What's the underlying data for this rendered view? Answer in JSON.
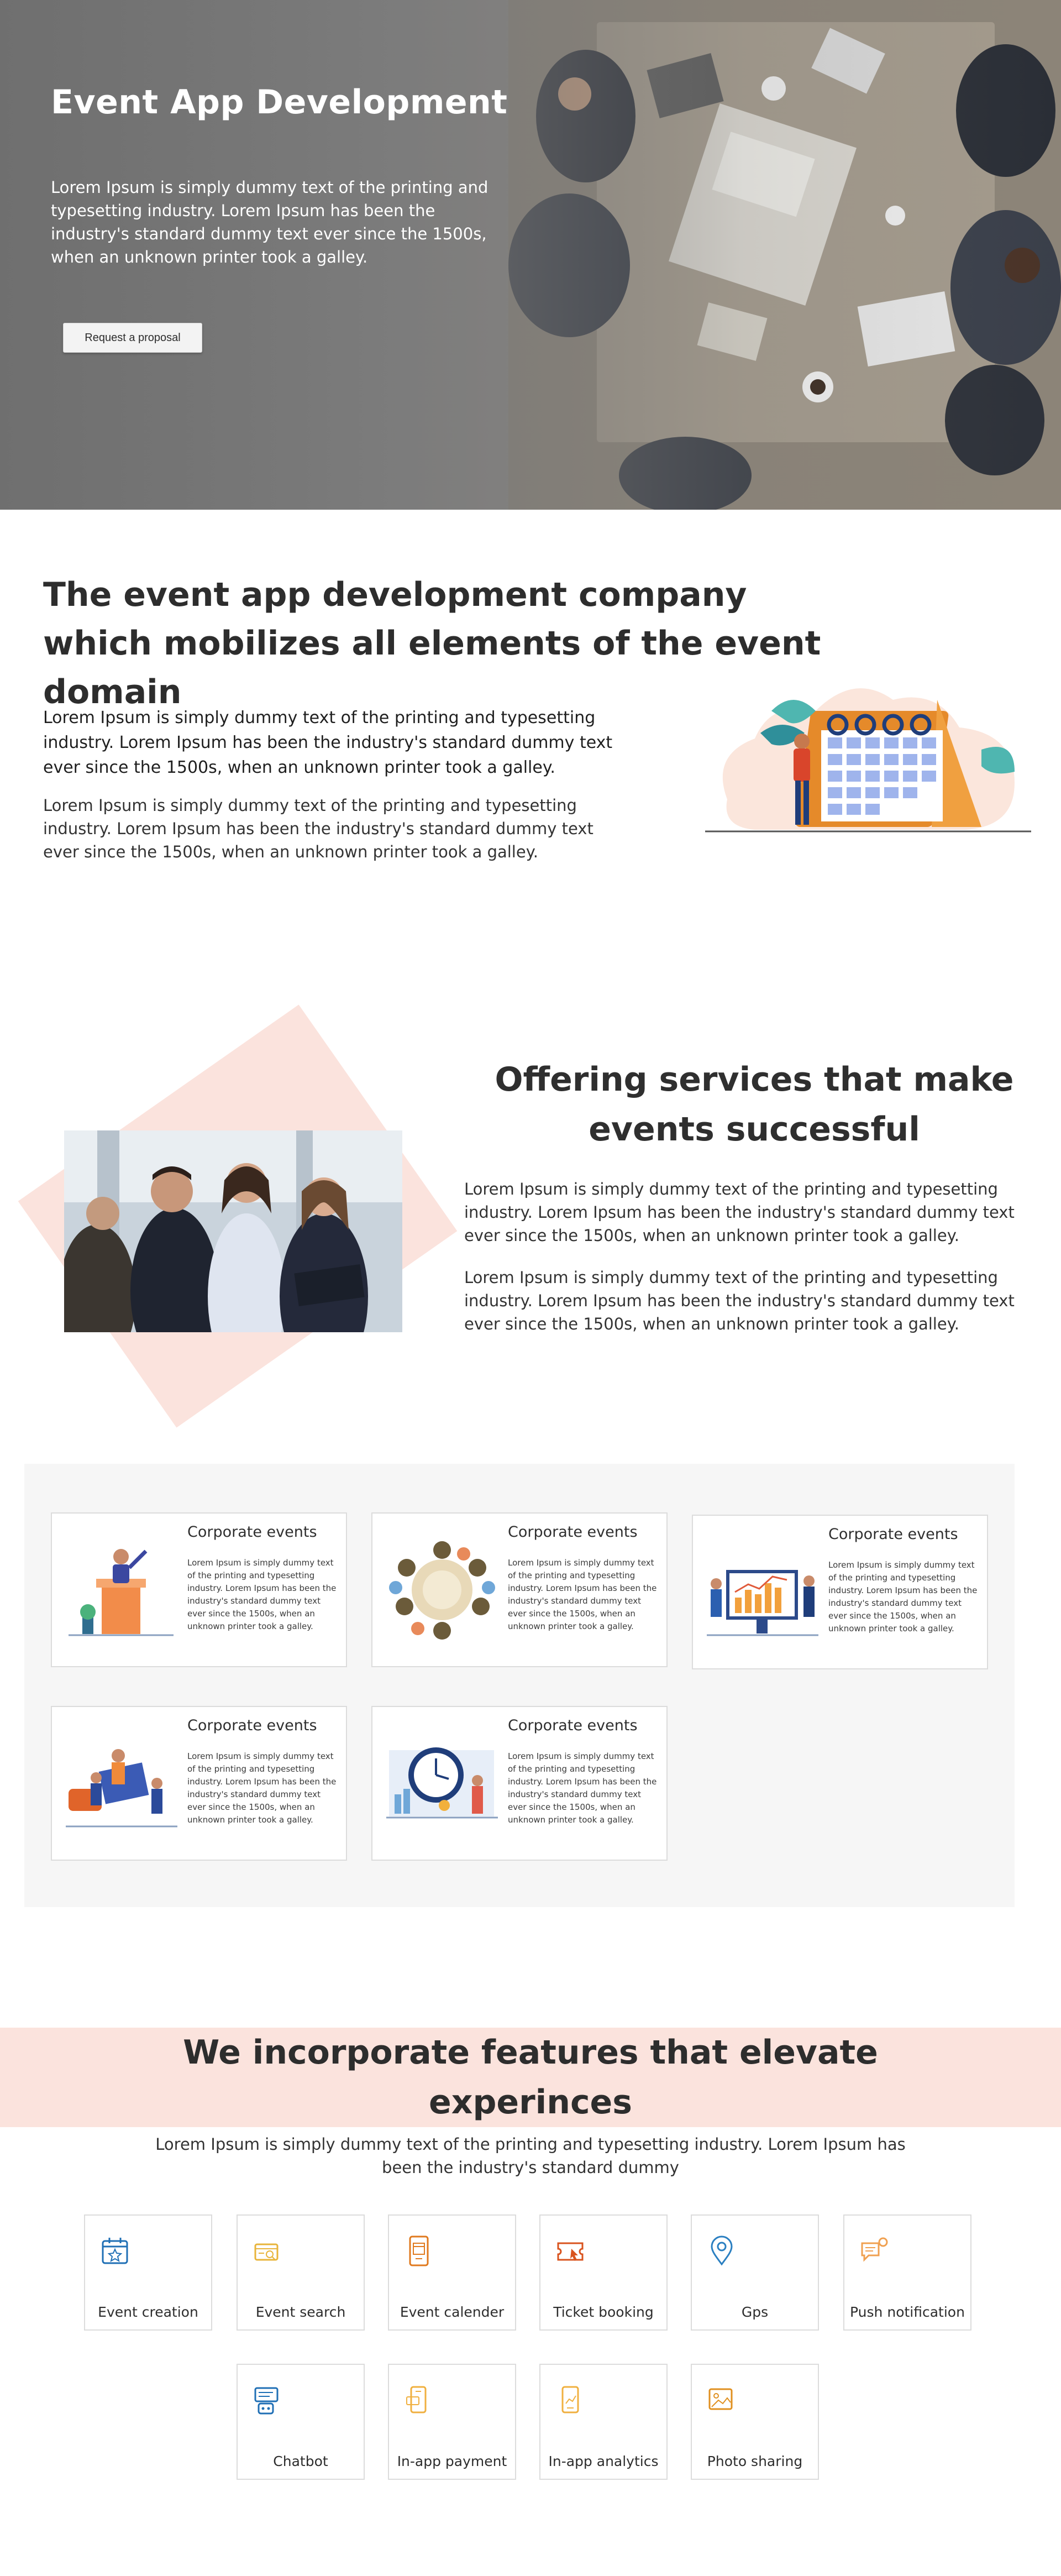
{
  "hero": {
    "title": "Event App Development",
    "text": "Lorem Ipsum is simply dummy text of the printing and typesetting industry. Lorem Ipsum has been the industry's standard dummy text ever since the 1500s, when an unknown printer took a galley.",
    "button_label": "Request a proposal"
  },
  "intro": {
    "title": "The event app development company which mobilizes all elements of the event domain",
    "lead": "Lorem Ipsum is simply dummy text of the printing and typesetting industry. Lorem Ipsum has been the industry's standard dummy text ever since the 1500s, when an unknown printer took a galley.",
    "text": "Lorem Ipsum is simply dummy text of the printing and typesetting industry. Lorem Ipsum has been the industry's standard dummy text ever since the 1500s, when an unknown printer took a galley."
  },
  "services": {
    "title": "Offering services that make events successful",
    "p1": "Lorem Ipsum is simply dummy text of the printing and typesetting industry. Lorem Ipsum has been the industry's standard dummy text ever since the 1500s, when an unknown printer took a galley.",
    "p2": "Lorem Ipsum is simply dummy text of the printing and typesetting industry. Lorem Ipsum has been the industry's standard dummy text ever since the 1500s, when an unknown printer took a galley."
  },
  "cards": [
    {
      "title": "Corporate events",
      "text": "Lorem Ipsum is simply dummy text of the printing and typesetting industry. Lorem Ipsum has been the industry's standard dummy text ever since the 1500s, when an unknown printer took a galley.",
      "icon": "speaker-podium-illustration"
    },
    {
      "title": "Corporate events",
      "text": "Lorem Ipsum is simply dummy text of the printing and typesetting industry. Lorem Ipsum has been the industry's standard dummy text ever since the 1500s, when an unknown printer took a galley.",
      "icon": "round-table-meeting-illustration"
    },
    {
      "title": "Corporate events",
      "text": "Lorem Ipsum is simply dummy text of the printing and typesetting industry. Lorem Ipsum has been the industry's standard dummy text ever since the 1500s, when an unknown printer took a galley.",
      "icon": "presentation-chart-illustration"
    },
    {
      "title": "Corporate events",
      "text": "Lorem Ipsum is simply dummy text of the printing and typesetting industry. Lorem Ipsum has been the industry's standard dummy text ever since the 1500s, when an unknown printer took a galley.",
      "icon": "team-building-illustration"
    },
    {
      "title": "Corporate events",
      "text": "Lorem Ipsum is simply dummy text of the printing and typesetting industry. Lorem Ipsum has been the industry's standard dummy text ever since the 1500s, when an unknown printer took a galley.",
      "icon": "clock-planning-illustration"
    }
  ],
  "features": {
    "title": "We incorporate features that elevate experinces",
    "subtitle": "Lorem Ipsum is simply dummy text of the printing and typesetting industry. Lorem Ipsum has been the industry's standard dummy",
    "items": [
      {
        "label": "Event creation",
        "icon": "calendar-star-icon",
        "color": "#1f6fb5"
      },
      {
        "label": "Event search",
        "icon": "ticket-search-icon",
        "color": "#e8b43a"
      },
      {
        "label": "Event calender",
        "icon": "mobile-calendar-icon",
        "color": "#e07a1f"
      },
      {
        "label": "Ticket booking",
        "icon": "ticket-cursor-icon",
        "color": "#d9531e"
      },
      {
        "label": "Gps",
        "icon": "location-pin-icon",
        "color": "#2a7fc1"
      },
      {
        "label": "Push notification",
        "icon": "notification-chat-icon",
        "color": "#f0a050"
      },
      {
        "label": "Chatbot",
        "icon": "chatbot-icon",
        "color": "#1f6fb5"
      },
      {
        "label": "In-app payment",
        "icon": "phone-payment-icon",
        "color": "#f0b040"
      },
      {
        "label": "In-app analytics",
        "icon": "phone-analytics-icon",
        "color": "#f0b040"
      },
      {
        "label": "Photo sharing",
        "icon": "photo-icon",
        "color": "#e09020"
      }
    ]
  }
}
